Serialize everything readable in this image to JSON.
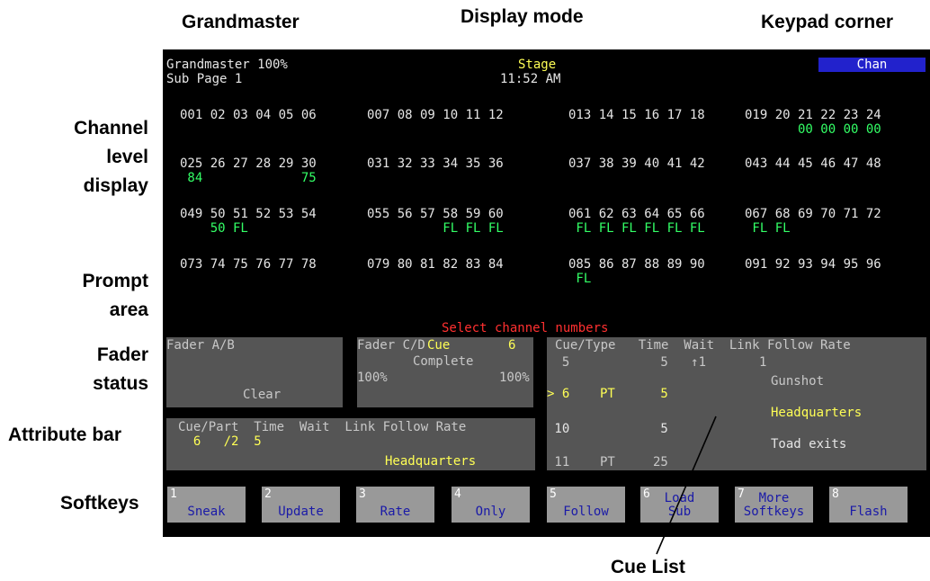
{
  "callouts": {
    "grandmaster": "Grandmaster",
    "display_mode": "Display mode",
    "keypad_corner": "Keypad corner",
    "channel_level_display": [
      "Channel",
      "level",
      "display"
    ],
    "prompt_area": [
      "Prompt",
      "area"
    ],
    "fader_status": [
      "Fader",
      "status"
    ],
    "attribute_bar": "Attribute bar",
    "softkeys": "Softkeys",
    "cue_list": "Cue List"
  },
  "header": {
    "grandmaster": "Grandmaster 100%",
    "sub_page": "Sub Page 1",
    "mode": "Stage",
    "time": "11:52 AM",
    "keypad": "Chan"
  },
  "channel_rows": [
    {
      "groups": [
        "001 02 03 04 05 06",
        "007 08 09 10 11 12",
        "013 14 15 16 17 18",
        "019 20 21 22 23 24"
      ],
      "levels": [
        "",
        "",
        "",
        "       00 00 00 00"
      ]
    },
    {
      "groups": [
        "025 26 27 28 29 30",
        "031 32 33 34 35 36",
        "037 38 39 40 41 42",
        "043 44 45 46 47 48"
      ],
      "levels": [
        " 84             75",
        "",
        "",
        ""
      ]
    },
    {
      "groups": [
        "049 50 51 52 53 54",
        "055 56 57 58 59 60",
        "061 62 63 64 65 66",
        "067 68 69 70 71 72"
      ],
      "levels": [
        "    50 FL",
        "          FL FL FL",
        " FL FL FL FL FL FL",
        " FL FL"
      ]
    },
    {
      "groups": [
        "073 74 75 76 77 78",
        "079 80 81 82 83 84",
        "085 86 87 88 89 90",
        "091 92 93 94 95 96"
      ],
      "levels": [
        "",
        "",
        " FL",
        ""
      ]
    }
  ],
  "prompt": "Select channel numbers",
  "fader_ab": {
    "title": "Fader A/B",
    "status": "Clear"
  },
  "fader_cd": {
    "title": "Fader C/D",
    "cue_label": "Cue",
    "cue_number": "6",
    "status": "Complete",
    "left_level": "100%",
    "right_level": "100%"
  },
  "attribute_bar": {
    "headers": "Cue/Part  Time  Wait  Link Follow Rate",
    "values": "  6   /2  5",
    "label": "Headquarters"
  },
  "cue_list": {
    "headers": "Cue/Type   Time  Wait  Link Follow Rate",
    "rows": [
      {
        "line": "  5            5   ↑1       1",
        "label": "Gunshot",
        "style": "gr"
      },
      {
        "line": "> 6    PT      5",
        "label": "Headquarters",
        "style": "y"
      },
      {
        "line": " 10            5",
        "label": "Toad exits",
        "style": "w"
      },
      {
        "line": " 11    PT     25",
        "label": "",
        "style": "gr"
      }
    ]
  },
  "softkeys": [
    {
      "num": "1",
      "label": "Sneak"
    },
    {
      "num": "2",
      "label": "Update"
    },
    {
      "num": "3",
      "label": "Rate"
    },
    {
      "num": "4",
      "label": "Only"
    },
    {
      "num": "5",
      "label": "Follow"
    },
    {
      "num": "6",
      "label": "Load\nSub"
    },
    {
      "num": "7",
      "label": "More\nSoftkeys"
    },
    {
      "num": "8",
      "label": "Flash"
    }
  ]
}
